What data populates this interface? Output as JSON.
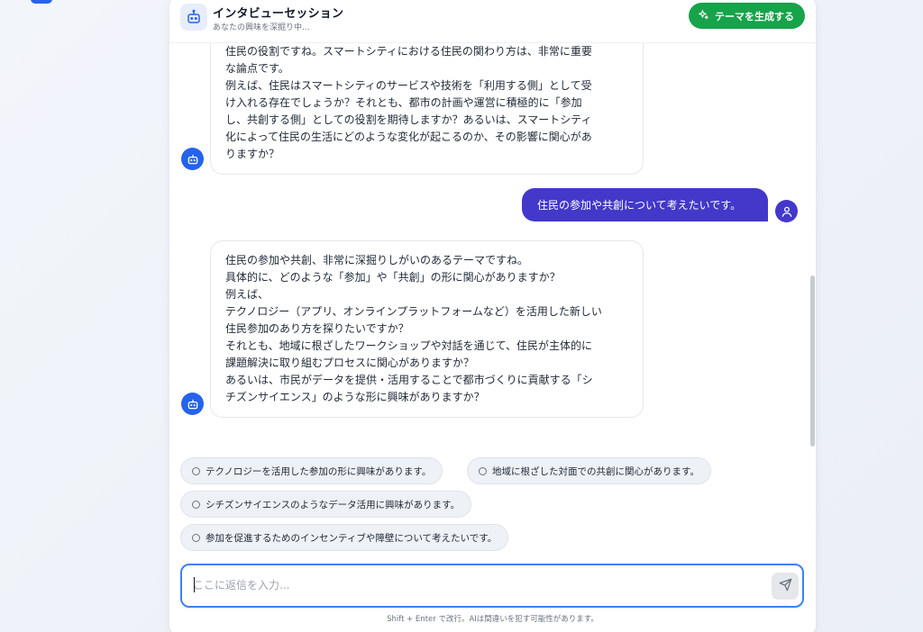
{
  "header": {
    "title": "インタビューセッション",
    "subtitle": "あなたの興味を深掘り中...",
    "generate_button": "テーマを生成する"
  },
  "messages": {
    "bot1_lines": [
      "住民の役割ですね。スマートシティにおける住民の関わり方は、非常に重要",
      "な論点です。",
      "例えば、住民はスマートシティのサービスや技術を「利用する側」として受",
      "け入れる存在でしょうか？それとも、都市の計画や運営に積極的に「参加",
      "し、共創する側」としての役割を期待しますか？あるいは、スマートシティ",
      "化によって住民の生活にどのような変化が起こるのか、その影響に関心があ",
      "りますか？"
    ],
    "user1": "住民の参加や共創について考えたいです。",
    "bot2_lines": [
      "住民の参加や共創、非常に深掘りしがいのあるテーマですね。",
      "具体的に、どのような「参加」や「共創」の形に関心がありますか？",
      "例えば、",
      "テクノロジー（アプリ、オンラインプラットフォームなど）を活用した新しい",
      "住民参加のあり方を探りたいですか？",
      "それとも、地域に根ざしたワークショップや対話を通じて、住民が主体的に",
      "課題解決に取り組むプロセスに関心がありますか？",
      "あるいは、市民がデータを提供・活用することで都市づくりに貢献する「シ",
      "チズンサイエンス」のような形に興味がありますか？"
    ]
  },
  "suggestions": [
    "テクノロジーを活用した参加の形に興味があります。",
    "地域に根ざした対面での共創に関心があります。",
    "シチズンサイエンスのようなデータ活用に興味があります。",
    "参加を促進するためのインセンティブや障壁について考えたいです。"
  ],
  "input": {
    "placeholder": "ここに返信を入力...",
    "hint": "Shift + Enter で改行。AIは間違いを犯す可能性があります。"
  },
  "colors": {
    "accent_blue": "#2563eb",
    "user_bubble": "#4338ca",
    "generate_green": "#16a34a"
  }
}
